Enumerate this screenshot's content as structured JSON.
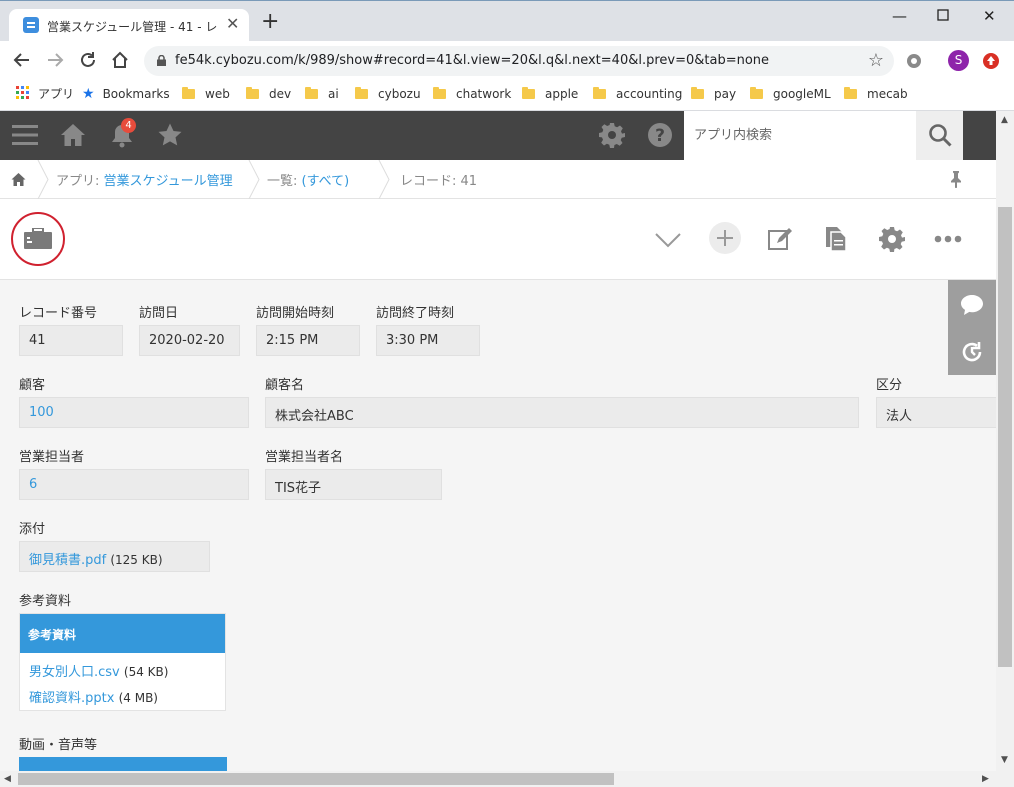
{
  "browser": {
    "tab_title": "営業スケジュール管理 - 41 - レコード(",
    "url": "fe54k.cybozu.com/k/989/show#record=41&l.view=20&l.q&l.next=40&l.prev=0&tab=none",
    "profile_initial": "S",
    "bookmarks": [
      "アプリ",
      "Bookmarks",
      "web",
      "dev",
      "ai",
      "cybozu",
      "chatwork",
      "apple",
      "accounting",
      "pay",
      "googleML",
      "mecab"
    ]
  },
  "header": {
    "notification_count": "4",
    "search_placeholder": "アプリ内検索"
  },
  "breadcrumb": {
    "app_prefix": "アプリ: ",
    "app_name": "営業スケジュール管理",
    "view_prefix": "一覧: ",
    "view_name": "(すべて)",
    "record": "レコード: 41"
  },
  "record": {
    "record_number": {
      "label": "レコード番号",
      "value": "41"
    },
    "visit_date": {
      "label": "訪問日",
      "value": "2020-02-20"
    },
    "visit_start": {
      "label": "訪問開始時刻",
      "value": "2:15 PM"
    },
    "visit_end": {
      "label": "訪問終了時刻",
      "value": "3:30 PM"
    },
    "customer": {
      "label": "顧客",
      "value": "100"
    },
    "customer_name": {
      "label": "顧客名",
      "value": "株式会社ABC"
    },
    "category": {
      "label": "区分",
      "value": "法人"
    },
    "sales_rep": {
      "label": "営業担当者",
      "value": "6"
    },
    "sales_rep_name": {
      "label": "営業担当者名",
      "value": "TIS花子"
    },
    "attachment": {
      "label": "添付",
      "file": "御見積書.pdf",
      "size": "(125 KB)"
    },
    "references": {
      "label": "参考資料",
      "table_header": "参考資料",
      "files": [
        {
          "name": "男女別人口.csv",
          "size": "(54 KB)"
        },
        {
          "name": "確認資料.pptx",
          "size": "(4 MB)"
        }
      ]
    },
    "media": {
      "label": "動画・音声等"
    }
  }
}
